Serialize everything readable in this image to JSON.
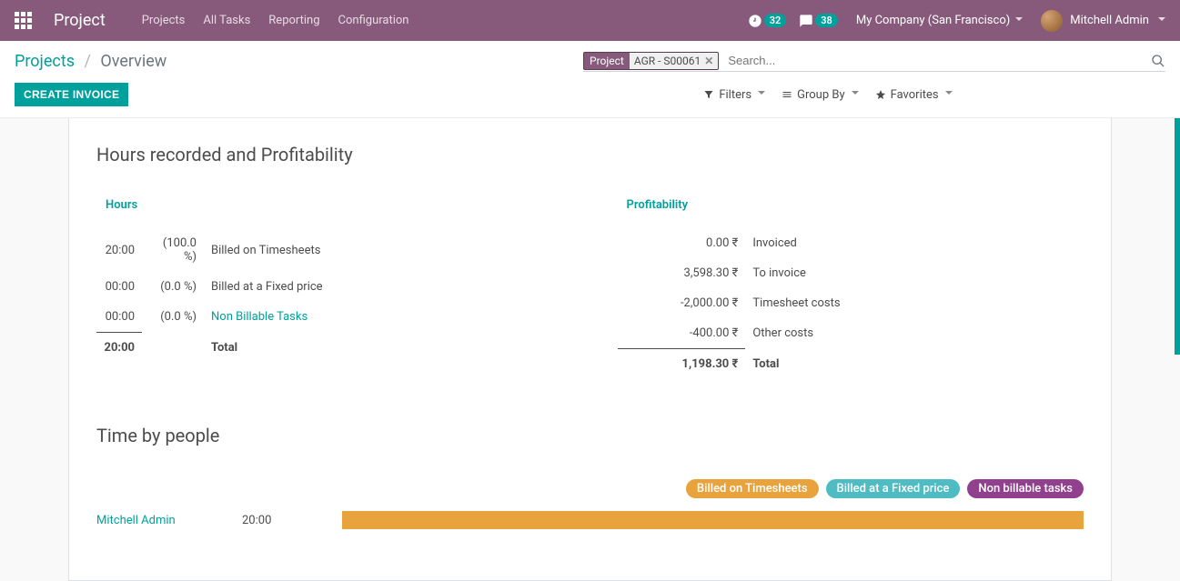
{
  "nav": {
    "brand": "Project",
    "items": [
      "Projects",
      "All Tasks",
      "Reporting",
      "Configuration"
    ],
    "clock_count": "32",
    "chat_count": "38",
    "company": "My Company (San Francisco)",
    "user": "Mitchell Admin"
  },
  "breadcrumb": {
    "link": "Projects",
    "current": "Overview"
  },
  "buttons": {
    "create_invoice": "CREATE INVOICE"
  },
  "search": {
    "facet_label": "Project",
    "facet_value": "AGR - S00061",
    "placeholder": "Search..."
  },
  "filters": {
    "filters": "Filters",
    "group_by": "Group By",
    "favorites": "Favorites"
  },
  "section1": {
    "title": "Hours recorded and Profitability",
    "hours_header": "Hours",
    "profit_header": "Profitability",
    "hours_rows": [
      {
        "h": "20:00",
        "p": "(100.0 %)",
        "label": "Billed on Timesheets",
        "link": false
      },
      {
        "h": "00:00",
        "p": "(0.0 %)",
        "label": "Billed at a Fixed price",
        "link": false
      },
      {
        "h": "00:00",
        "p": "(0.0 %)",
        "label": "Non Billable Tasks",
        "link": true
      }
    ],
    "hours_total": {
      "h": "20:00",
      "label": "Total"
    },
    "profit_rows": [
      {
        "amt": "0.00 ₹",
        "label": "Invoiced"
      },
      {
        "amt": "3,598.30 ₹",
        "label": "To invoice"
      },
      {
        "amt": "-2,000.00 ₹",
        "label": "Timesheet costs"
      },
      {
        "amt": "-400.00 ₹",
        "label": "Other costs"
      }
    ],
    "profit_total": {
      "amt": "1,198.30 ₹",
      "label": "Total"
    }
  },
  "section2": {
    "title": "Time by people",
    "legend": {
      "billed_ts": "Billed on Timesheets",
      "billed_fixed": "Billed at a Fixed price",
      "non_billable": "Non billable tasks"
    },
    "rows": [
      {
        "name": "Mitchell Admin",
        "hours": "20:00"
      }
    ]
  },
  "chart_data": {
    "type": "bar",
    "orientation": "horizontal",
    "stacked": true,
    "categories": [
      "Mitchell Admin"
    ],
    "series": [
      {
        "name": "Billed on Timesheets",
        "color": "#e8a33d",
        "values": [
          20.0
        ]
      },
      {
        "name": "Billed at a Fixed price",
        "color": "#4fbbc2",
        "values": [
          0.0
        ]
      },
      {
        "name": "Non billable tasks",
        "color": "#90408c",
        "values": [
          0.0
        ]
      }
    ],
    "xlabel": "",
    "ylabel": "",
    "unit": "hours"
  }
}
